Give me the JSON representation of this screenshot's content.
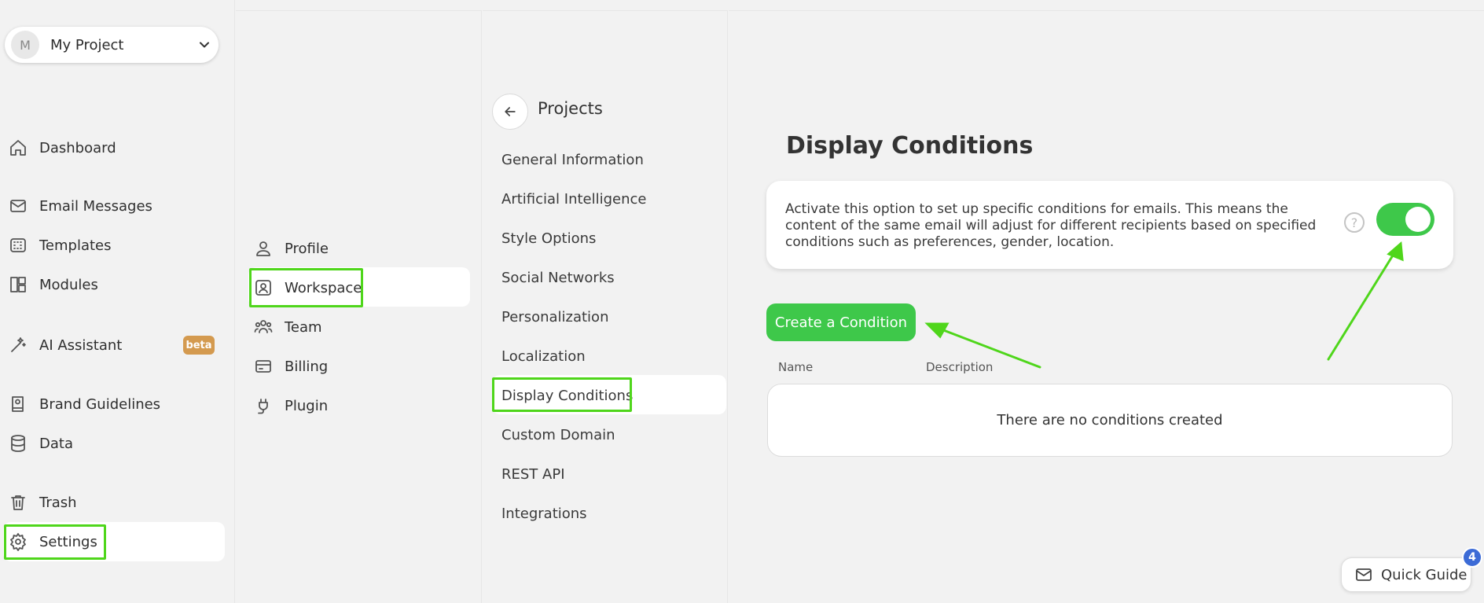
{
  "project": {
    "avatar_letter": "M",
    "name": "My Project"
  },
  "sidebar": {
    "items": [
      {
        "label": "Dashboard",
        "icon": "home-icon"
      },
      {
        "label": "Email Messages",
        "icon": "mail-icon"
      },
      {
        "label": "Templates",
        "icon": "templates-icon"
      },
      {
        "label": "Modules",
        "icon": "modules-icon"
      },
      {
        "label": "AI Assistant",
        "icon": "magic-wand-icon",
        "badge": "beta"
      },
      {
        "label": "Brand Guidelines",
        "icon": "book-icon"
      },
      {
        "label": "Data",
        "icon": "database-icon"
      },
      {
        "label": "Trash",
        "icon": "trash-icon"
      },
      {
        "label": "Settings",
        "icon": "gear-icon",
        "active": true
      }
    ]
  },
  "settings_nav": {
    "items": [
      {
        "label": "Profile",
        "icon": "user-icon"
      },
      {
        "label": "Workspace",
        "icon": "workspace-icon",
        "active": true
      },
      {
        "label": "Team",
        "icon": "team-icon"
      },
      {
        "label": "Billing",
        "icon": "card-icon"
      },
      {
        "label": "Plugin",
        "icon": "plug-icon"
      }
    ]
  },
  "workspace_nav": {
    "title": "Projects",
    "items": [
      "General Information",
      "Artificial Intelligence",
      "Style Options",
      "Social Networks",
      "Personalization",
      "Localization",
      "Display Conditions",
      "Custom Domain",
      "REST API",
      "Integrations"
    ],
    "active_index": 6
  },
  "main": {
    "title": "Display Conditions",
    "description": "Activate this option to set up specific conditions for emails. This means the content of the same email will adjust for different recipients based on specified conditions such as preferences, gender, location.",
    "help_symbol": "?",
    "toggle_on": true,
    "create_button": "Create a Condition",
    "columns": [
      "Name",
      "Description"
    ],
    "empty_message": "There are no conditions created"
  },
  "quick_guide": {
    "label": "Quick Guide",
    "count": "4"
  },
  "colors": {
    "accent_green": "#3ec84a",
    "highlight_green": "#4fd61b",
    "badge_orange": "#d49a4f",
    "badge_blue": "#3c6bd6"
  }
}
